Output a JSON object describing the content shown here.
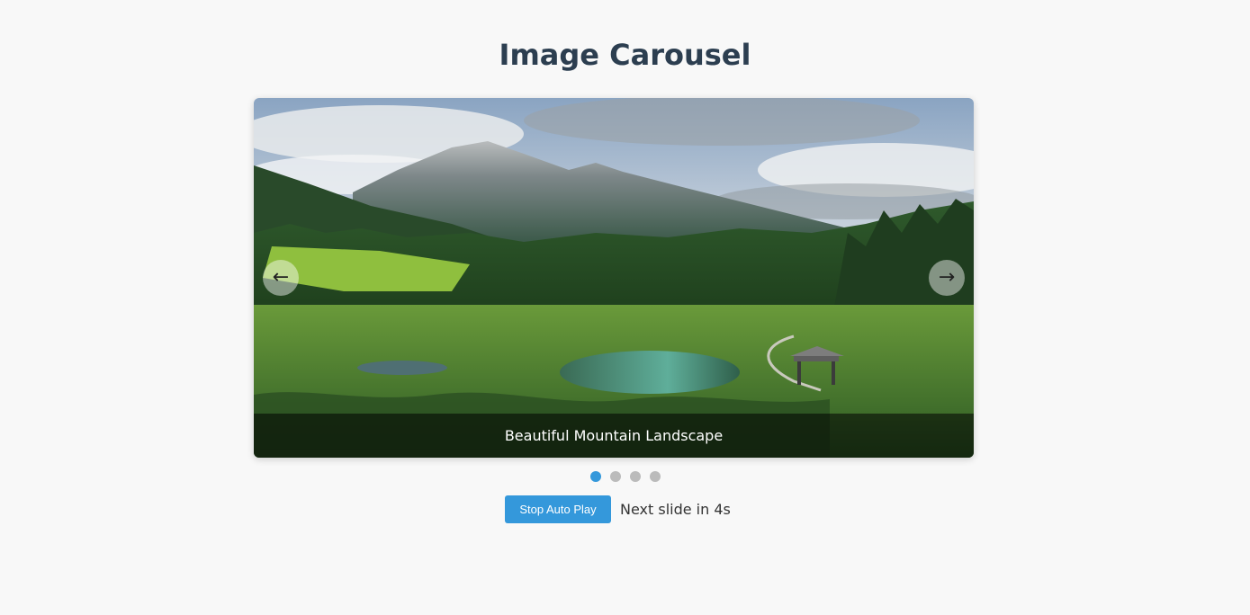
{
  "page": {
    "title": "Image Carousel"
  },
  "carousel": {
    "slides": [
      {
        "caption": "Beautiful Mountain Landscape",
        "active": true
      },
      {
        "active": false
      },
      {
        "active": false
      },
      {
        "active": false
      }
    ],
    "current_caption": "Beautiful Mountain Landscape",
    "prev_icon": "←",
    "next_icon": "→"
  },
  "controls": {
    "autoplay_label": "Stop Auto Play",
    "countdown_text": "Next slide in 4s"
  },
  "colors": {
    "accent": "#3498db",
    "title": "#2c3e50",
    "inactive_dot": "#bbbbbb",
    "background": "#f8f8f8"
  }
}
